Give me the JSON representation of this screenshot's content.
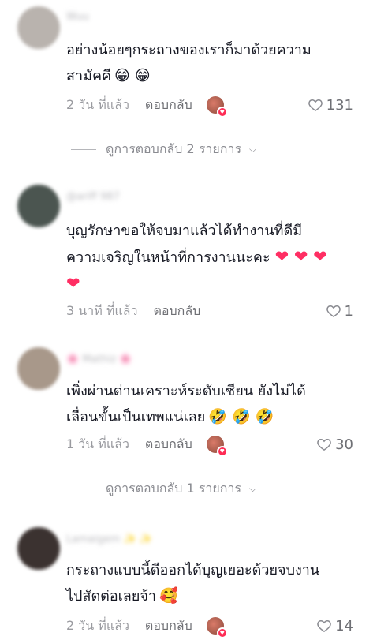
{
  "comments": [
    {
      "username": "Wuu",
      "avatar_color": "#b9b3ae",
      "text_line1": "อย่างน้อยๆกระถางของเราก็มาด้วยความ",
      "text_line2": "สามัคคี",
      "emoji": "😁 😁",
      "time": "2 วัน ที่แล้ว",
      "reply_label": "ตอบกลับ",
      "likes": "131",
      "creator_liked": true
    },
    {
      "username": "@ariff 987",
      "avatar_color": "#4b5550",
      "text_line1": "บุญรักษาขอให้จบมาแล้วได้ทำงานที่ดีมี",
      "text_line2": "ความเจริญในหน้าที่การงานนะคะ",
      "emoji": "❤ ❤ ❤",
      "emoji_line3": "❤",
      "time": "3 นาที ที่แล้ว",
      "reply_label": "ตอบกลับ",
      "likes": "1",
      "creator_liked": false
    },
    {
      "username": "🌸 Mathiz 🌸",
      "avatar_color": "#a8988a",
      "text_line1": "เพิ่งผ่านด่านเคราะห์ระดับเซียน ยังไม่ได้",
      "text_line2": "เลื่อนขั้นเป็นเทพแน่เลย",
      "emoji": "🤣 🤣 🤣",
      "time": "1 วัน ที่แล้ว",
      "reply_label": "ตอบกลับ",
      "likes": "30",
      "creator_liked": true
    },
    {
      "username": "Lamaigem ✨ ✨",
      "avatar_color": "#3b3230",
      "text_line1": "กระถางแบบนี้ดีออกได้บุญเยอะด้วยจบงาน",
      "text_line2": "ไปสัดต่อเลยจ้า",
      "emoji": "🥰",
      "time": "2 วัน ที่แล้ว",
      "reply_label": "ตอบกลับ",
      "likes": "14",
      "creator_liked": true
    }
  ],
  "reply_toggles": [
    {
      "label": "ดูการตอบกลับ 2 รายการ"
    },
    {
      "label": "ดูการตอบกลับ 1 รายการ"
    }
  ],
  "icons": {
    "like": "heart-outline-icon",
    "expand": "chevron-down-icon"
  }
}
